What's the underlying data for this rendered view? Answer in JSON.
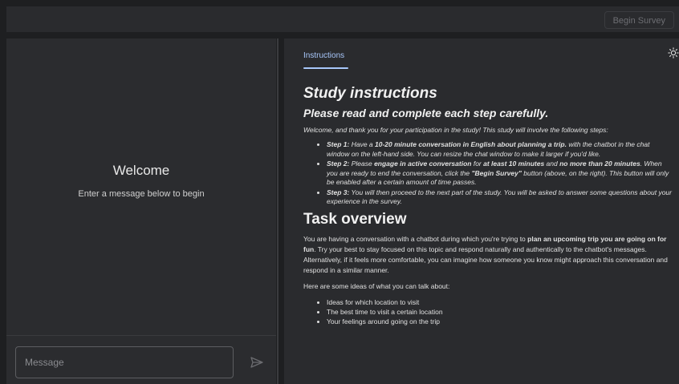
{
  "header": {
    "begin_survey_label": "Begin Survey"
  },
  "chat": {
    "welcome_title": "Welcome",
    "welcome_subtitle": "Enter a message below to begin",
    "message_placeholder": "Message",
    "send_icon": "send-icon"
  },
  "instructions": {
    "tab_label": "Instructions",
    "theme_icon": "sun-icon",
    "title": "Study instructions",
    "subtitle": "Please read and complete each step carefully.",
    "intro": "Welcome, and thank you for your participation in the study! This study will involve the following steps:",
    "steps": [
      {
        "label": "Step 1:",
        "t1": " Have a ",
        "b1": "10-20 minute conversation in English about planning a trip.",
        "t2": " with the chatbot in the chat window on the left-hand side. You can resize the chat window to make it larger if you'd like."
      },
      {
        "label": "Step 2:",
        "t1": " Please ",
        "b1": "engage in active conversation",
        "t2": " for ",
        "b2": "at least 10 minutes",
        "t3": " and ",
        "b3": "no more than 20 minutes",
        "t4": ". When you are ready to end the conversation, click the ",
        "b4": "\"Begin Survey\"",
        "t5": " button (above, on the right). This button will only be enabled after a certain amount of time passes."
      },
      {
        "label": "Step 3:",
        "t1": " You will then proceed to the next part of the study. You will be asked to answer some questions about your experience in the survey."
      }
    ],
    "task_heading": "Task overview",
    "overview": {
      "t1": "You are having a conversation with a chatbot during which you're trying to ",
      "b1": "plan an upcoming trip you are going on for fun",
      "t2": ". Try your best to stay focused on this topic and respond naturally and authentically to the chatbot's messages. Alternatively, if it feels more comfortable, you can imagine how someone you know might approach this conversation and respond in a similar manner."
    },
    "ideas_intro": "Here are some ideas of what you can talk about:",
    "ideas": [
      "Ideas for which location to visit",
      "The best time to visit a certain location",
      "Your feelings around going on the trip"
    ]
  }
}
